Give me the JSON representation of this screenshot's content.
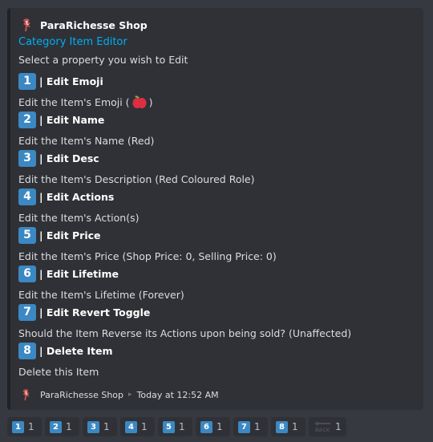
{
  "author": {
    "name": "ParaRichesse Shop"
  },
  "title": "Category Item Editor",
  "description": "Select a property you wish to Edit",
  "fields": [
    {
      "num": "1",
      "name": "| Edit Emoji",
      "value_prefix": "Edit the Item's Emoji (",
      "value_suffix": ")",
      "value_icon": "red-apple-icon"
    },
    {
      "num": "2",
      "name": "| Edit Name",
      "value": "Edit the Item's Name (Red)"
    },
    {
      "num": "3",
      "name": "| Edit Desc",
      "value": "Edit the Item's Description (Red Coloured Role)"
    },
    {
      "num": "4",
      "name": "| Edit Actions",
      "value": "Edit the Item's Action(s)"
    },
    {
      "num": "5",
      "name": "| Edit Price",
      "value": "Edit the Item's Price (Shop Price: 0, Selling Price: 0)"
    },
    {
      "num": "6",
      "name": "| Edit Lifetime",
      "value": "Edit the Item's Lifetime (Forever)"
    },
    {
      "num": "7",
      "name": "| Edit Revert Toggle",
      "value": "Should the Item Reverse its Actions upon being sold? (Unaffected)"
    },
    {
      "num": "8",
      "name": "| Delete Item",
      "value": "Delete this Item"
    }
  ],
  "footer": {
    "text": "ParaRichesse Shop",
    "separator": "▸",
    "timestamp": "Today at 12:52 AM"
  },
  "reactions": [
    {
      "emoji": "1",
      "count": "1"
    },
    {
      "emoji": "2",
      "count": "1"
    },
    {
      "emoji": "3",
      "count": "1"
    },
    {
      "emoji": "4",
      "count": "1"
    },
    {
      "emoji": "5",
      "count": "1"
    },
    {
      "emoji": "6",
      "count": "1"
    },
    {
      "emoji": "7",
      "count": "1"
    },
    {
      "emoji": "8",
      "count": "1"
    },
    {
      "emoji": "back-arrow-icon",
      "count": "1"
    }
  ],
  "colors": {
    "keycap": "#3b88c3",
    "link": "#00aff4",
    "embed_bg": "#2f3136",
    "page_bg": "#36393f"
  }
}
